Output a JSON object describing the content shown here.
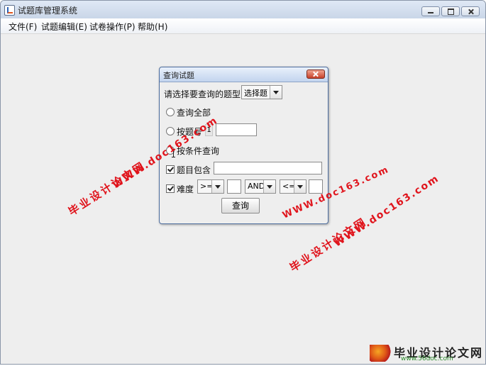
{
  "window": {
    "title": "试题库管理系统",
    "controls": [
      "minimize-icon",
      "maximize-icon",
      "close-icon"
    ]
  },
  "menubar": {
    "items": [
      "文件(F)",
      "试题编辑(E)",
      "试卷操作(P)",
      "帮助(H)"
    ]
  },
  "dialog": {
    "title": "查询试题",
    "type_prompt": "请选择要查询的题型:",
    "type_select": "选择题",
    "radio_all": "查询全部",
    "radio_by_number": "按题号",
    "number_value": "1",
    "number_input": "",
    "radio_by_condition": "按条件查询",
    "contains_label": "题目包含",
    "contains_checked": true,
    "contains_input": "",
    "difficulty_label": "难度",
    "difficulty_checked": true,
    "op1": ">=",
    "value1": "",
    "logic": "AND",
    "op2": "<=",
    "value2": "",
    "query_button": "查询"
  },
  "watermarks": {
    "cn": "毕业设计论文网",
    "url": "WWW.doc163.com"
  },
  "logo": {
    "text": "毕业设计论文网",
    "url": "www.56doc.com",
    "colors": {
      "red": "#e0141c",
      "green": "#2b8a2b"
    }
  }
}
